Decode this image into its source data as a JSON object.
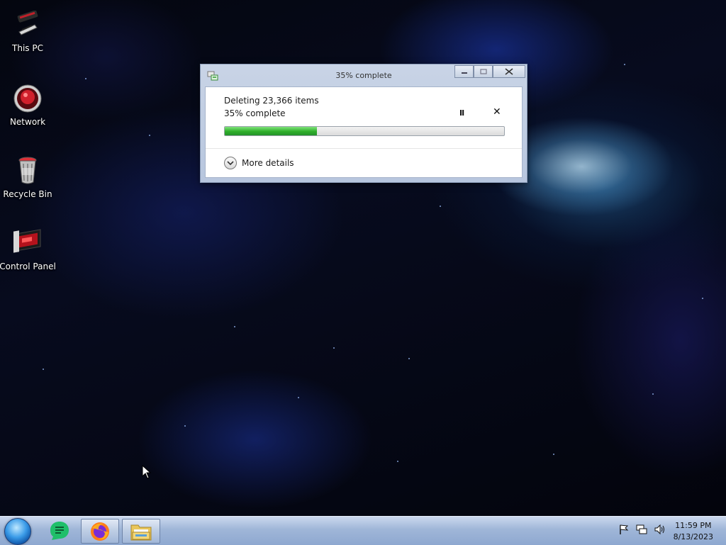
{
  "desktop": {
    "icons": [
      {
        "label": "This PC",
        "icon": "computer-icon"
      },
      {
        "label": "Network",
        "icon": "network-icon"
      },
      {
        "label": "Recycle Bin",
        "icon": "recycle-bin-icon"
      },
      {
        "label": "Control Panel",
        "icon": "control-panel-icon"
      }
    ]
  },
  "dialog": {
    "title": "35% complete",
    "heading": "Deleting 23,366 items",
    "status": "35% complete",
    "progress": 0.33,
    "pause_label": "II",
    "stop_label": "✕",
    "details_label": "More details",
    "buttons": {
      "minimize": "minimize",
      "maximize": "maximize",
      "close": "close"
    }
  },
  "taskbar": {
    "start": "start-button",
    "pinned": [
      {
        "name": "messages-app",
        "icon": "chat-icon"
      },
      {
        "name": "firefox",
        "icon": "firefox-icon"
      },
      {
        "name": "file-explorer",
        "icon": "folder-icon"
      }
    ],
    "tray": [
      "flag-icon",
      "network-icon",
      "volume-icon"
    ],
    "time": "11:59 PM",
    "date": "8/13/2023"
  },
  "colors": {
    "progress_fill": "#2fae2a",
    "taskbar": "#9fb6d8",
    "dialog_frame": "#b7c6de"
  }
}
